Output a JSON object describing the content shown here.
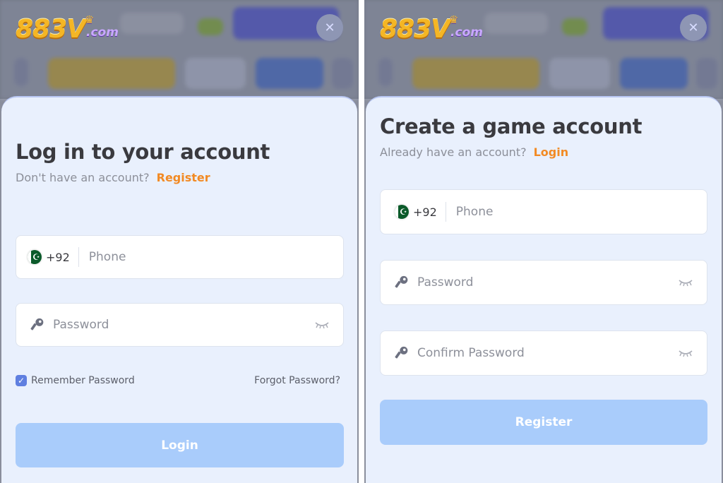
{
  "logo": {
    "main": "883V",
    "suffix": ".com"
  },
  "login": {
    "title": "Log in to your account",
    "subtitle": "Don't have an account?",
    "link": "Register",
    "phone_code": "+92",
    "phone_placeholder": "Phone",
    "password_placeholder": "Password",
    "remember_label": "Remember Password",
    "remember_checked": true,
    "forgot_label": "Forgot Password?",
    "button_label": "Login"
  },
  "register": {
    "title": "Create a game account",
    "subtitle": "Already have an account?",
    "link": "Login",
    "phone_code": "+92",
    "phone_placeholder": "Phone",
    "password_placeholder": "Password",
    "confirm_placeholder": "Confirm Password",
    "button_label": "Register"
  },
  "colors": {
    "accent": "#f28a24",
    "button": "#a9ccfb",
    "sheet": "#e9f0fd",
    "checkbox": "#5f7fe0"
  },
  "icons": {
    "close": "close-icon",
    "flag": "pakistan-flag-icon",
    "key": "key-icon",
    "eye": "eye-closed-icon",
    "crown": "crown-icon"
  }
}
